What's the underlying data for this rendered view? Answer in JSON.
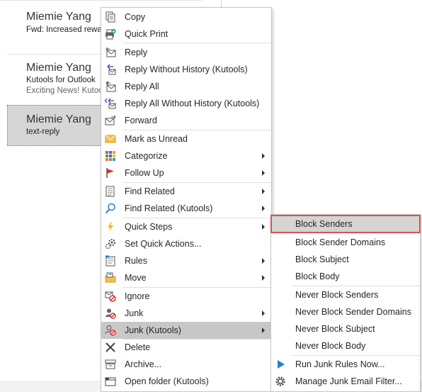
{
  "mail_list": {
    "items": [
      {
        "sender": "Miemie Yang",
        "subject": "Fwd: Increased rewa",
        "preview": ""
      },
      {
        "sender": "Miemie Yang",
        "subject": "Kutools for Outlook",
        "preview": "Exciting News! Kutoo"
      },
      {
        "sender": "Miemie Yang",
        "subject": "text-reply",
        "preview": ""
      }
    ]
  },
  "context_menu": {
    "items": [
      {
        "label": "Copy",
        "icon": "copy-icon"
      },
      {
        "label": "Quick Print",
        "icon": "quick-print-icon"
      },
      {
        "label": "Reply",
        "icon": "reply-icon"
      },
      {
        "label": "Reply Without History (Kutools)",
        "icon": "reply-without-history-icon"
      },
      {
        "label": "Reply All",
        "icon": "reply-all-icon"
      },
      {
        "label": "Reply All Without History (Kutools)",
        "icon": "reply-all-without-history-icon"
      },
      {
        "label": "Forward",
        "icon": "forward-icon"
      },
      {
        "label": "Mark as Unread",
        "icon": "mark-unread-icon"
      },
      {
        "label": "Categorize",
        "icon": "categorize-icon"
      },
      {
        "label": "Follow Up",
        "icon": "follow-up-flag-icon"
      },
      {
        "label": "Find Related",
        "icon": "find-related-icon"
      },
      {
        "label": "Find Related (Kutools)",
        "icon": "search-icon"
      },
      {
        "label": "Quick Steps",
        "icon": "lightning-icon"
      },
      {
        "label": "Set Quick Actions...",
        "icon": "quick-actions-icon"
      },
      {
        "label": "Rules",
        "icon": "rules-icon"
      },
      {
        "label": "Move",
        "icon": "move-folder-icon"
      },
      {
        "label": "Ignore",
        "icon": "ignore-icon"
      },
      {
        "label": "Junk",
        "icon": "junk-icon"
      },
      {
        "label": "Junk (Kutools)",
        "icon": "junk-kutools-icon"
      },
      {
        "label": "Delete",
        "icon": "delete-x-icon"
      },
      {
        "label": "Archive...",
        "icon": "archive-icon"
      },
      {
        "label": "Open folder (Kutools)",
        "icon": "open-folder-icon"
      }
    ]
  },
  "junk_submenu": {
    "items": [
      {
        "label": "Block Senders"
      },
      {
        "label": "Block Sender Domains"
      },
      {
        "label": "Block Subject"
      },
      {
        "label": "Block Body"
      },
      {
        "label": "Never Block Senders"
      },
      {
        "label": "Never Block Sender Domains"
      },
      {
        "label": "Never Block Subject"
      },
      {
        "label": "Never Block Body"
      },
      {
        "label": "Run Junk Rules Now...",
        "icon": "play-icon"
      },
      {
        "label": "Manage Junk Email Filter...",
        "icon": "gear-icon"
      }
    ]
  },
  "colors": {
    "highlight": "#c8c8c8",
    "focus_outline": "#d9534f",
    "accent_blue": "#2b7cd3"
  }
}
